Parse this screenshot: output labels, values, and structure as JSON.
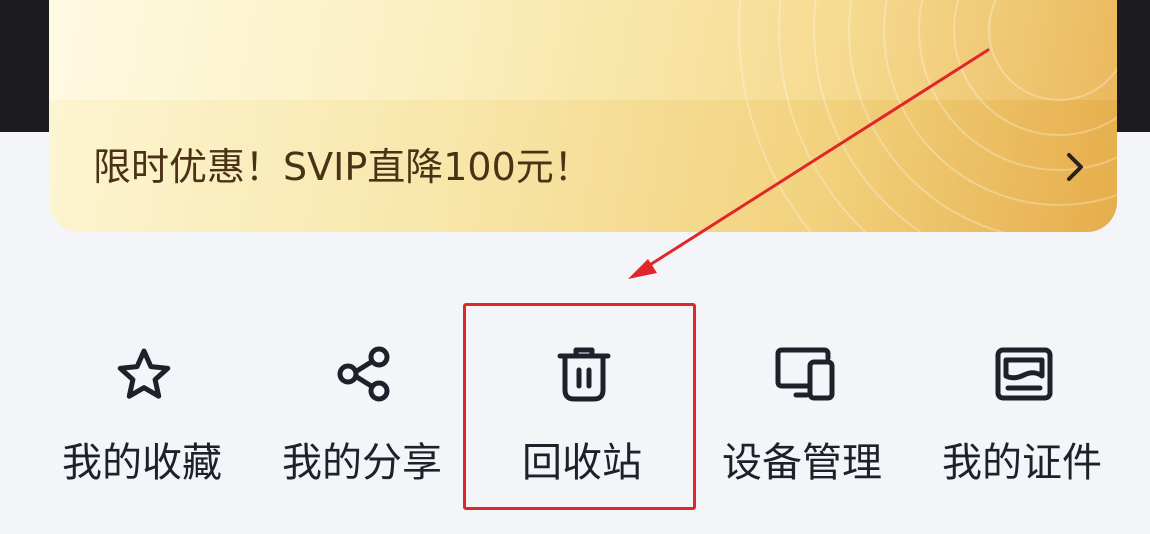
{
  "promo": {
    "text": "限时优惠！SVIP直降100元！",
    "chevron_icon": "chevron-right-icon",
    "colors": {
      "gradient_start": "#fdf5d3",
      "gradient_end": "#e6ad4b",
      "text": "#4a3216"
    }
  },
  "tools": [
    {
      "label": "我的收藏",
      "icon": "star-icon"
    },
    {
      "label": "我的分享",
      "icon": "share-icon"
    },
    {
      "label": "回收站",
      "icon": "trash-icon"
    },
    {
      "label": "设备管理",
      "icon": "devices-icon"
    },
    {
      "label": "我的证件",
      "icon": "id-card-icon"
    }
  ],
  "annotation": {
    "highlight_target": "回收站",
    "color": "#e0262b"
  },
  "colors": {
    "background": "#f3f5f9",
    "label_text": "#1e2129",
    "icon_stroke": "#1e2129"
  }
}
